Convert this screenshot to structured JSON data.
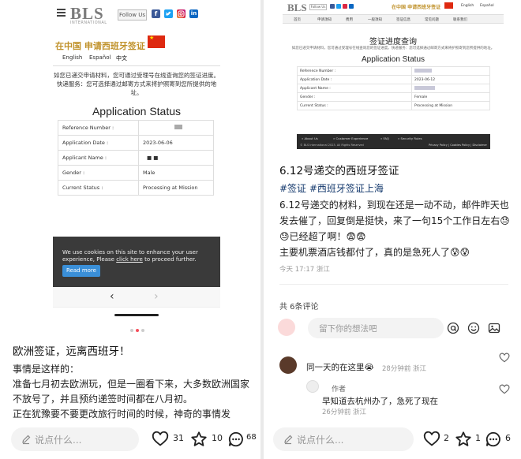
{
  "left": {
    "bls": {
      "logo": "BLS",
      "logo_sub": "INTERNATIONAL",
      "follow_label": "Follow Us",
      "social": {
        "facebook": "f",
        "linkedin": "in"
      },
      "title": "在中国 申请西班牙签证",
      "languages": [
        "English",
        "Español",
        "中文"
      ],
      "description": "如您已递交申请材料，您可通过受理号在线查询您的签证进度。快递服务：您可选择通过邮寄方式来将护照寄到您所提供的地址。",
      "status_heading": "Application Status",
      "rows": [
        {
          "label": "Reference Number :",
          "value": ""
        },
        {
          "label": "Application Date :",
          "value": "2023-06-06"
        },
        {
          "label": "Applicant Name :",
          "value": "■ ■"
        },
        {
          "label": "Gender :",
          "value": "Male"
        },
        {
          "label": "Current Status :",
          "value": "Processing at Mission"
        }
      ],
      "cookie_pre": "We use cookies on this site to enhance your user experience, Please ",
      "cookie_link": "click here",
      "cookie_post": " to proceed further.",
      "cookie_button": "Read more",
      "nav_prev": "‹",
      "nav_next": "›"
    },
    "post": {
      "title": "欧洲签证，远离西班牙！",
      "body": "事情是这样的：\n准备七月初去欧洲玩，但是一圈看下来，大多数欧洲国家不放号了，并且预约递签时间都在八月初。\n正在犹豫要不要更改旅行时间的时候，神奇的事情发"
    },
    "bottom": {
      "placeholder": "说点什么...",
      "likes": "31",
      "stars": "10",
      "comments": "68"
    }
  },
  "right": {
    "bls": {
      "logo": "BLS",
      "follow_label": "Follow Us",
      "title": "在中国 申请西班牙签证",
      "languages": [
        "English",
        "Español"
      ],
      "nav": [
        "首页",
        "申请须知",
        "费用",
        "一般须知",
        "签证信息",
        "常见问题",
        "联系我们"
      ],
      "heading": "签证进度查询",
      "description": "如您已递交申请材料，您可通过受理号在线查询您的签证进度。快递服务：您可选择通过邮寄方式来将护照寄到您所提供的地址。",
      "status_heading": "Application Status",
      "rows": [
        {
          "label": "Reference Number :",
          "value": ""
        },
        {
          "label": "Application Date :",
          "value": "2023-06-12"
        },
        {
          "label": "Applicant Name :",
          "value": ""
        },
        {
          "label": "Gender :",
          "value": "Female"
        },
        {
          "label": "Current Status :",
          "value": "Processing at Mission"
        }
      ],
      "footer_links": [
        "» About Us",
        "» Customer Experience",
        "» FAQ",
        "» Security Rules"
      ],
      "footer_copy": "© BLS International 2023. All Rights Reserved",
      "footer_right": "Privacy Policy | Cookies Policy | Disclaimer"
    },
    "post": {
      "title": "6.12号递交的西班牙签证",
      "tags": "#签证 #西班牙签证上海",
      "body": "6.12号递交的材料，到现在还是一动不动，邮件昨天也发去催了，回复倒是挺快，来了一句15个工作日左右😓😓已经超了啊！😨😨\n主要机票酒店钱都付了，真的是急死人了😰😰",
      "meta": "今天 17:17 浙江"
    },
    "comments": {
      "count_label": "共 6条评论",
      "input_placeholder": "留下你的想法吧",
      "items": [
        {
          "text": "同一天的在这里😭",
          "time": "28分钟前 浙江"
        },
        {
          "badge": "作者",
          "text": "早知道去杭州办了，急死了现在",
          "time": "26分钟前 浙江"
        }
      ]
    },
    "bottom": {
      "placeholder": "说点什么...",
      "likes": "2",
      "stars": "1",
      "comments": "6"
    }
  },
  "colors": {
    "accent": "#f54f5b",
    "gold": "#c0922b",
    "tag_blue": "#13386c",
    "cookie_btn": "#3a8fd8"
  },
  "icons": [
    "hamburger-icon",
    "heart-icon",
    "star-icon",
    "comment-icon",
    "pencil-icon",
    "at-icon",
    "emoji-icon",
    "image-icon"
  ]
}
